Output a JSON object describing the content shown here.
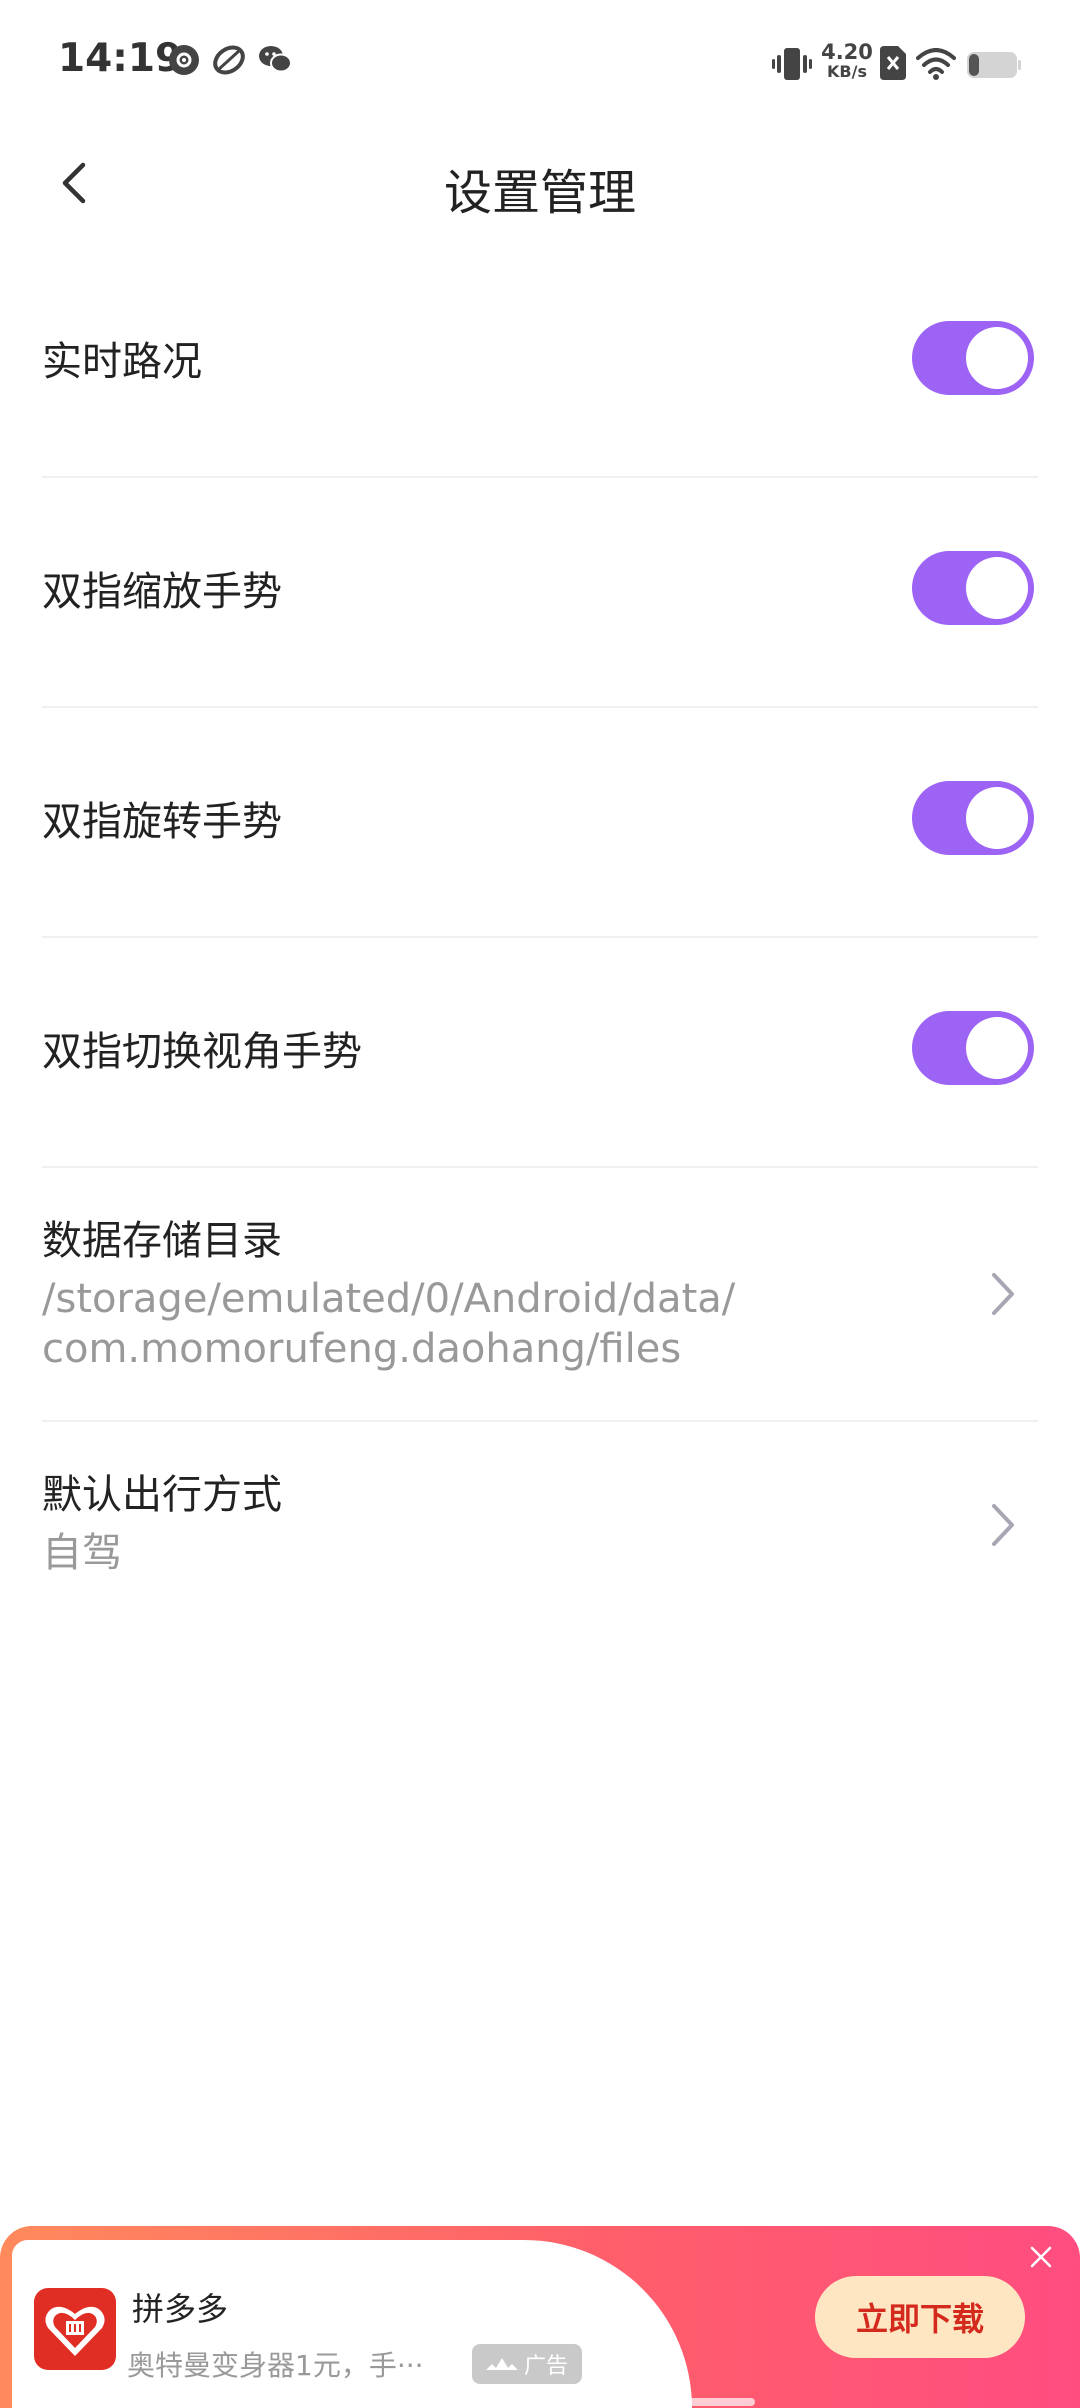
{
  "status_bar": {
    "time": "14:19",
    "net_speed_value": "4.20",
    "net_speed_unit": "KB/s",
    "icons": [
      "music-disc-icon",
      "app-leaf-icon",
      "wechat-icon",
      "vibrate-icon",
      "no-sim-icon",
      "wifi-icon",
      "battery-icon"
    ]
  },
  "header": {
    "title": "设置管理",
    "back_icon": "chevron-left-icon"
  },
  "settings": {
    "toggles": [
      {
        "label": "实时路况",
        "on": true
      },
      {
        "label": "双指缩放手势",
        "on": true
      },
      {
        "label": "双指旋转手势",
        "on": true
      },
      {
        "label": "双指切换视角手势",
        "on": true
      }
    ],
    "storage": {
      "title": "数据存储目录",
      "line1": "/storage/emulated/0/Android/data/",
      "line2": "com.momorufeng.daohang/files"
    },
    "travel_mode": {
      "title": "默认出行方式",
      "value": "自驾"
    }
  },
  "ad": {
    "app_name": "拼多多",
    "description": "奥特曼变身器1元，手···",
    "tag": "广告",
    "download_label": "立即下载"
  },
  "colors": {
    "toggle_on": "#9c63f5",
    "title_text": "#222222",
    "secondary_text": "#999999",
    "ad_gradient_start": "#ff8a5c",
    "ad_gradient_end": "#ff4d80",
    "ad_button_text": "#d42a1e"
  }
}
